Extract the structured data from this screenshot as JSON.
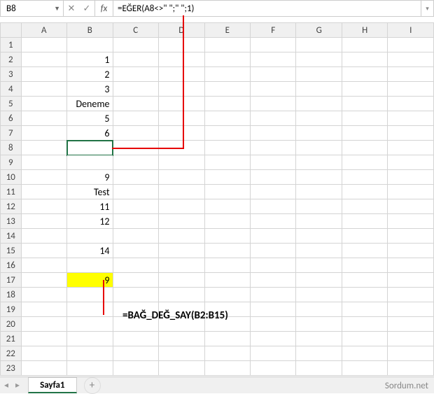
{
  "namebox": "B8",
  "formula": "=EĞER(A8<>\" \";\" \";1)",
  "columns": [
    "A",
    "B",
    "C",
    "D",
    "E",
    "F",
    "G",
    "H",
    "I"
  ],
  "rows": {
    "1": {
      "B": ""
    },
    "2": {
      "B": "1"
    },
    "3": {
      "B": "2"
    },
    "4": {
      "B": "3"
    },
    "5": {
      "B": "Deneme"
    },
    "6": {
      "B": "5"
    },
    "7": {
      "B": "6"
    },
    "8": {
      "B": ""
    },
    "9": {
      "B": ""
    },
    "10": {
      "B": "9"
    },
    "11": {
      "B": "Test"
    },
    "12": {
      "B": "11"
    },
    "13": {
      "B": "12"
    },
    "14": {
      "B": ""
    },
    "15": {
      "B": "14"
    },
    "16": {
      "B": ""
    },
    "17": {
      "B": "9"
    },
    "18": {
      "B": ""
    },
    "19": {
      "B": ""
    },
    "20": {
      "B": ""
    },
    "21": {
      "B": ""
    },
    "22": {
      "B": ""
    },
    "23": {
      "B": ""
    }
  },
  "annotation": "=BAĞ_DEĞ_SAY(B2:B15)",
  "sheet": "Sayfa1",
  "watermark": "Sordum.net",
  "chart_data": {
    "type": "table",
    "note": "Excel worksheet screenshot",
    "selected_cell": "B8",
    "formula_in_B8": "=EĞER(A8<>\" \";\" \";1)",
    "values_B2_B15": [
      "1",
      "2",
      "3",
      "Deneme",
      "5",
      "6",
      "",
      "",
      "9",
      "Test",
      "11",
      "12",
      "",
      "14"
    ],
    "result_B17": 9,
    "result_formula": "=BAĞ_DEĞ_SAY(B2:B15)"
  }
}
